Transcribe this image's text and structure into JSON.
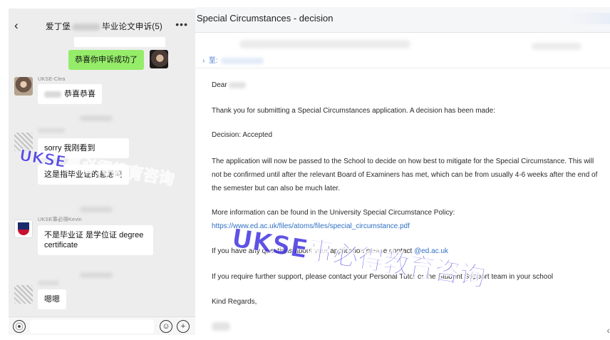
{
  "chat": {
    "header": {
      "back_icon": "chevron-left-icon",
      "title_prefix": "爱丁堡",
      "title_suffix": "毕业论文申诉(5)",
      "more_icon": "more-dots-icon"
    },
    "messages": [
      {
        "id": "m1",
        "side": "right",
        "sender": "",
        "text": "恭喜你申诉成功了"
      },
      {
        "id": "m2",
        "side": "left",
        "sender": "UKSE-Clea",
        "text": "恭喜恭喜"
      },
      {
        "id": "m3",
        "side": "left",
        "sender": "",
        "text": "sorry 我刚看到"
      },
      {
        "id": "m4",
        "side": "left",
        "sender": "",
        "text": "这是指毕业证的意思吗"
      },
      {
        "id": "m5",
        "side": "left",
        "sender": "UKSE事必得Kevin",
        "text": "不是毕业证 是学位证 degree certificate"
      },
      {
        "id": "m6",
        "side": "left",
        "sender": "",
        "text": "嗯嗯"
      }
    ],
    "input": {
      "voice_icon": "voice-icon",
      "emoji_icon": "emoji-icon",
      "plus_icon": "plus-icon"
    }
  },
  "email": {
    "subject": "Special Circumstances - decision",
    "to_label": "至:",
    "greeting": "Dear",
    "p1": "Thank you for submitting a Special Circumstances application. A decision has been made:",
    "decision": "Decision: Accepted",
    "p2": "The application will now be passed to the School to decide on how best to mitigate for the Special Circumstance. This will not be confirmed until after the relevant Board of Examiners has met, which can be from usually 4-6 weeks after the end of the semester but can also be much later.",
    "p3_text": "More information can be found in the University Special Circumstance Policy: ",
    "p3_link": "https://www.ed.ac.uk/files/atoms/files/special_circumstance.pdf",
    "p4_text": "If you have any questions about your application please contact ",
    "p4_link": "@ed.ac.uk",
    "p5": "If you require further support, please contact your Personal Tutor or the Student Support team in your school",
    "closing": "Kind Regards,"
  },
  "watermark": {
    "text": "UKSE事必得教育咨询",
    "color": "#3b2de0"
  }
}
